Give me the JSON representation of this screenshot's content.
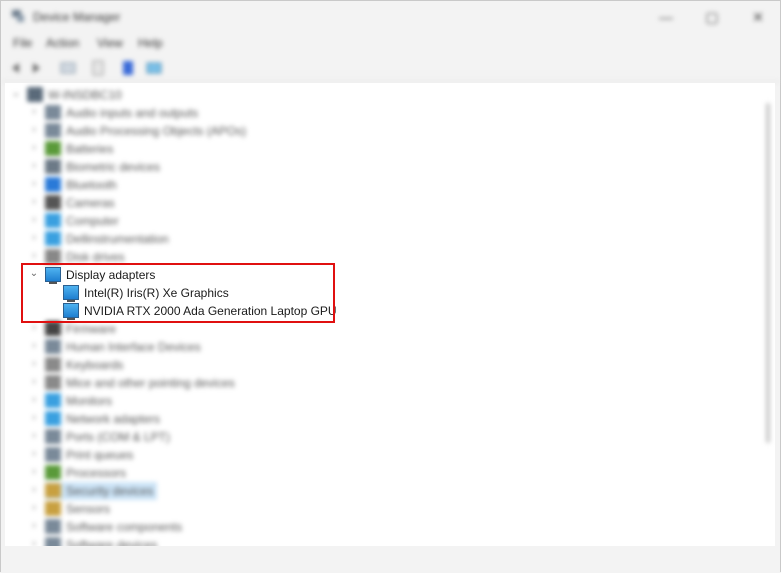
{
  "window": {
    "title": "Device Manager",
    "controls": {
      "minimize": "—",
      "maximize": "▢",
      "close": "✕"
    }
  },
  "menu": [
    "File",
    "Action",
    "View",
    "Help"
  ],
  "tree": {
    "root_label": "W-INSDBC10",
    "categories_before": [
      {
        "label": "Audio inputs and outputs",
        "icon": "speaker-icon",
        "color": "#7a8a99"
      },
      {
        "label": "Audio Processing Objects (APOs)",
        "icon": "speaker-icon",
        "color": "#7a8a99"
      },
      {
        "label": "Batteries",
        "icon": "battery-icon",
        "color": "#5a9a3a"
      },
      {
        "label": "Biometric devices",
        "icon": "fingerprint-icon",
        "color": "#6c7a87"
      },
      {
        "label": "Bluetooth",
        "icon": "bluetooth-icon",
        "color": "#2a7ad8"
      },
      {
        "label": "Cameras",
        "icon": "camera-icon",
        "color": "#555555"
      },
      {
        "label": "Computer",
        "icon": "computer-icon",
        "color": "#3aa0e0"
      },
      {
        "label": "Dellinstrumentation",
        "icon": "device-icon",
        "color": "#3aa0e0"
      },
      {
        "label": "Disk drives",
        "icon": "disk-icon",
        "color": "#888888"
      }
    ],
    "display_adapters": {
      "label": "Display adapters",
      "children": [
        "Intel(R) Iris(R) Xe Graphics",
        "NVIDIA RTX 2000 Ada Generation Laptop GPU"
      ]
    },
    "categories_after": [
      {
        "label": "Firmware",
        "icon": "chip-icon",
        "color": "#444444"
      },
      {
        "label": "Human Interface Devices",
        "icon": "hid-icon",
        "color": "#7a8a99"
      },
      {
        "label": "Keyboards",
        "icon": "keyboard-icon",
        "color": "#8a8a8a"
      },
      {
        "label": "Mice and other pointing devices",
        "icon": "mouse-icon",
        "color": "#8a8a8a"
      },
      {
        "label": "Monitors",
        "icon": "monitor-icon",
        "color": "#3aa0e0"
      },
      {
        "label": "Network adapters",
        "icon": "network-icon",
        "color": "#3aa0e0"
      },
      {
        "label": "Ports (COM & LPT)",
        "icon": "port-icon",
        "color": "#7a8a99"
      },
      {
        "label": "Print queues",
        "icon": "printer-icon",
        "color": "#7a8a99"
      },
      {
        "label": "Processors",
        "icon": "processor-icon",
        "color": "#5a9a3a"
      },
      {
        "label": "Security devices",
        "icon": "security-icon",
        "color": "#c8a040"
      },
      {
        "label": "Sensors",
        "icon": "sensor-icon",
        "color": "#c8a040"
      },
      {
        "label": "Software components",
        "icon": "component-icon",
        "color": "#7a8a99"
      },
      {
        "label": "Software devices",
        "icon": "component-icon",
        "color": "#7a8a99"
      }
    ]
  },
  "colors": {
    "highlight_border": "#e01010",
    "selection": "#cce4f7"
  }
}
